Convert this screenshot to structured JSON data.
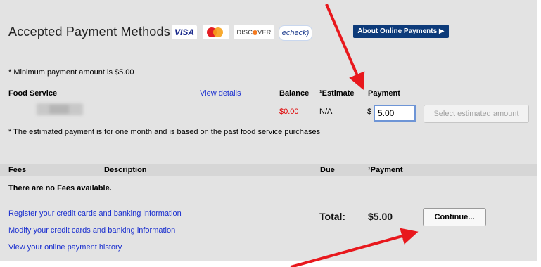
{
  "header": {
    "title": "Accepted Payment Methods",
    "logos": {
      "visa": "VISA",
      "discover": "DISC",
      "discover_tail": "VER",
      "echeck": "echeck)"
    },
    "about_button": "About Online Payments ▶"
  },
  "notes": {
    "minimum": "* Minimum payment amount is $5.00",
    "estimate_note": "* The estimated payment is for one month and is based on the past food service purchases"
  },
  "food_service": {
    "header": {
      "name": "Food Service",
      "view_details": "View details",
      "balance": "Balance",
      "estimate": "¹Estimate",
      "payment": "Payment"
    },
    "row": {
      "balance": "$0.00",
      "estimate": "N/A",
      "currency": "$",
      "payment_value": "5.00",
      "select_button": "Select estimated amount"
    }
  },
  "fees": {
    "header": {
      "fees": "Fees",
      "description": "Description",
      "due": "Due",
      "payment": "¹Payment"
    },
    "empty": "There are no Fees available."
  },
  "links": [
    "Register your credit cards and banking information",
    "Modify your credit cards and banking information",
    "View your online payment history"
  ],
  "total": {
    "label": "Total:",
    "value": "$5.00",
    "continue_button": "Continue..."
  },
  "colors": {
    "annotation_arrow": "#e8181d",
    "about_button_bg": "#0d3b7a",
    "link": "#1a2fcf",
    "balance_red": "#e00000"
  }
}
